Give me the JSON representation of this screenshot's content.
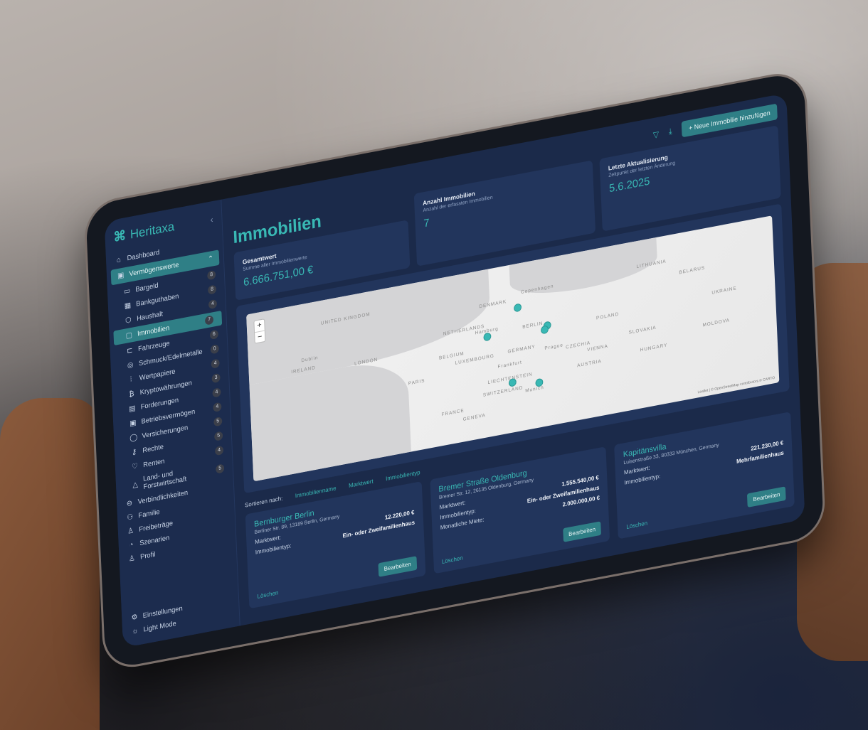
{
  "app": {
    "brand": "Heritaxa",
    "collapse_icon": "chevron-left-icon"
  },
  "sidebar": {
    "dashboard": "Dashboard",
    "group": "Vermögenswerte",
    "items": [
      {
        "label": "Bargeld",
        "count": "8",
        "icon": "cash-icon"
      },
      {
        "label": "Bankguthaben",
        "count": "8",
        "icon": "bank-icon"
      },
      {
        "label": "Haushalt",
        "count": "4",
        "icon": "box-icon"
      },
      {
        "label": "Immobilien",
        "count": "7",
        "icon": "building-icon",
        "active": true
      },
      {
        "label": "Fahrzeuge",
        "count": "6",
        "icon": "car-icon"
      },
      {
        "label": "Schmuck/Edelmetalle",
        "count": "0",
        "icon": "jewelry-icon"
      },
      {
        "label": "Wertpapiere",
        "count": "4",
        "icon": "bar-chart-icon"
      },
      {
        "label": "Kryptowährungen",
        "count": "3",
        "icon": "bitcoin-icon"
      },
      {
        "label": "Forderungen",
        "count": "4",
        "icon": "document-icon"
      },
      {
        "label": "Betriebsvermögen",
        "count": "4",
        "icon": "briefcase-icon"
      },
      {
        "label": "Versicherungen",
        "count": "5",
        "icon": "shield-icon"
      },
      {
        "label": "Rechte",
        "count": "5",
        "icon": "key-icon"
      },
      {
        "label": "Renten",
        "count": "4",
        "icon": "heart-icon"
      },
      {
        "label": "Land- und Forstwirtschaft",
        "count": "5",
        "icon": "mountain-icon"
      }
    ],
    "secondary": [
      {
        "label": "Verbindlichkeiten",
        "icon": "minus-circle-icon"
      },
      {
        "label": "Familie",
        "icon": "people-icon"
      },
      {
        "label": "Freibeträge",
        "icon": "award-icon"
      },
      {
        "label": "Szenarien",
        "icon": "pie-icon"
      },
      {
        "label": "Profil",
        "icon": "user-icon"
      }
    ],
    "settings": "Einstellungen",
    "light_mode": "Light Mode"
  },
  "toolbar": {
    "add_label": "+ Neue Immobilie hinzufügen"
  },
  "page": {
    "title": "Immobilien"
  },
  "stats": {
    "total": {
      "label": "Gesamtwert",
      "sub": "Summe aller Immobilienwerte",
      "value": "6.666.751,00 €"
    },
    "count": {
      "label": "Anzahl Immobilien",
      "sub": "Anzahl der erfassten Immobilien",
      "value": "7"
    },
    "updated": {
      "label": "Letzte Aktualisierung",
      "sub": "Zeitpunkt der letzten Änderung",
      "value": "5.6.2025"
    }
  },
  "map": {
    "labels": [
      "UNITED KINGDOM",
      "IRELAND",
      "Dublin",
      "LONDON",
      "NETHERLANDS",
      "BELGIUM",
      "LUXEMBOURG",
      "PARIS",
      "FRANCE",
      "GERMANY",
      "Hamburg",
      "BERLIN",
      "POLAND",
      "CZECHIA",
      "AUSTRIA",
      "VIENNA",
      "SLOVAKIA",
      "HUNGARY",
      "SWITZERLAND",
      "LIECHTENSTEIN",
      "GENEVA",
      "DENMARK",
      "Copenhagen",
      "LITHUANIA",
      "BELARUS",
      "UKRAINE",
      "MOLDOVA",
      "Frankfurt",
      "Prague",
      "Munich"
    ],
    "zoom_in": "+",
    "zoom_out": "−",
    "attribution": "Leaflet | © OpenStreetMap contributors © CARTO"
  },
  "sort": {
    "label": "Sortieren nach:",
    "options": [
      "Immobilienname",
      "Marktwert",
      "Immobilientyp"
    ]
  },
  "properties": [
    {
      "name": "Bernburger Berlin",
      "address": "Berliner Str. 89, 13189 Berlin, Germany",
      "rows": [
        {
          "k": "Marktwert:",
          "v": "12.220,00 €"
        },
        {
          "k": "Immobilientyp:",
          "v": "Ein- oder Zweifamilienhaus"
        }
      ],
      "edit": "Bearbeiten",
      "delete": "Löschen"
    },
    {
      "name": "Bremer Straße Oldenburg",
      "address": "Bremer Str. 12, 26135 Oldenburg, Germany",
      "rows": [
        {
          "k": "Marktwert:",
          "v": "1.555.540,00 €"
        },
        {
          "k": "Immobilientyp:",
          "v": "Ein- oder Zweifamilienhaus"
        },
        {
          "k": "Monatliche Miete:",
          "v": "2.000.000,00 €"
        }
      ],
      "edit": "Bearbeiten",
      "delete": "Löschen"
    },
    {
      "name": "Kapitänsvilla",
      "address": "Luisenstraße 33, 80333 München, Germany",
      "rows": [
        {
          "k": "Marktwert:",
          "v": "221.230,00 €"
        },
        {
          "k": "Immobilientyp:",
          "v": "Mehrfamilienhaus"
        }
      ],
      "edit": "Bearbeiten",
      "delete": "Löschen"
    }
  ]
}
